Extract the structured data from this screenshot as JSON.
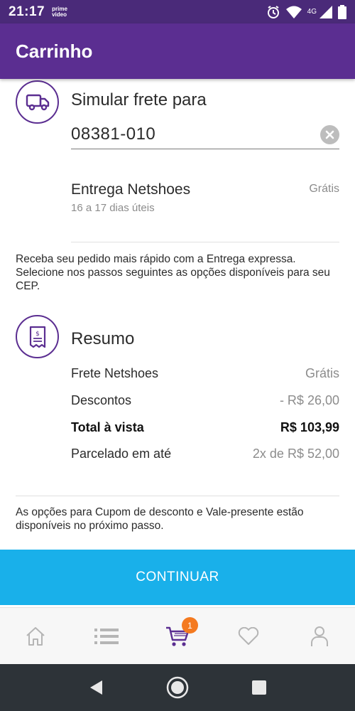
{
  "status_bar": {
    "time": "21:17",
    "prime_label": "prime video",
    "network": "4G"
  },
  "app_bar": {
    "title": "Carrinho"
  },
  "shipping": {
    "title": "Simular frete para",
    "cep_value": "08381-010",
    "option_name": "Entrega Netshoes",
    "option_eta": "16 a 17 dias úteis",
    "option_price": "Grátis",
    "express_note": "Receba seu pedido mais rápido com a Entrega expressa. Selecione nos passos seguintes as opções disponíveis para seu CEP."
  },
  "summary": {
    "title": "Resumo",
    "rows": [
      {
        "label": "Frete Netshoes",
        "value": "Grátis"
      },
      {
        "label": "Descontos",
        "value": "- R$ 26,00"
      },
      {
        "label": "Total à vista",
        "value": "R$ 103,99"
      },
      {
        "label": "Parcelado em até",
        "value": "2x de R$ 52,00"
      }
    ],
    "cupom_note": "As opções para Cupom de desconto e Vale-presente estão disponíveis no próximo passo."
  },
  "continue_label": "CONTINUAR",
  "bottom_nav": {
    "items": [
      "home-icon",
      "list-icon",
      "cart-icon",
      "heart-icon",
      "profile-icon"
    ],
    "cart_badge": "1"
  },
  "colors": {
    "primary": "#5b2e91",
    "status_bar": "#4a2a79",
    "accent_button": "#19b0ea",
    "badge": "#f47a20"
  }
}
